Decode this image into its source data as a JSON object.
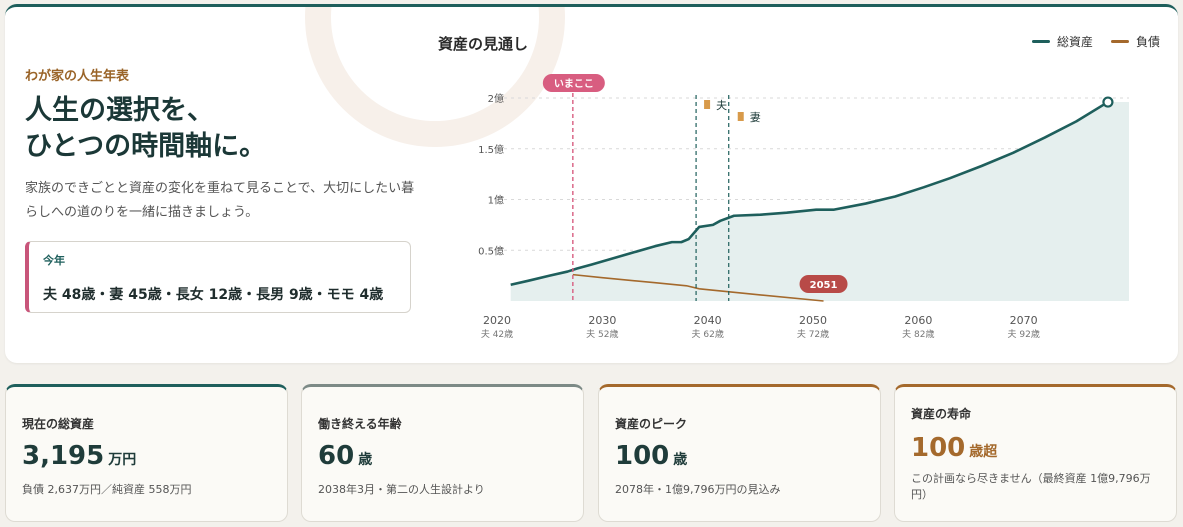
{
  "hero": {
    "eyebrow": "わが家の人生年表",
    "headline_line1": "人生の選択を、",
    "headline_line2": "ひとつの時間軸に。",
    "lead": "家族のできごとと資産の変化を重ねて見ることで、大切にしたい暮らしへの道のりを一緒に描きましょう。",
    "year_label": "今年",
    "members": "夫 48歳・妻 45歳・長女 12歳・長男 9歳・モモ 4歳"
  },
  "chart": {
    "title": "資産の見通し",
    "legend": [
      {
        "label": "総資産",
        "color": "#1e5f5c"
      },
      {
        "label": "負債",
        "color": "#a4692c"
      }
    ]
  },
  "chart_data": {
    "type": "area",
    "title": "資産の見通し",
    "x_range": [
      2020,
      2080
    ],
    "y_range": [
      0,
      2.0
    ],
    "y_unit": "億",
    "y_ticks": [
      {
        "value": 0.5,
        "label": "0.5億"
      },
      {
        "value": 1.0,
        "label": "1億"
      },
      {
        "value": 1.5,
        "label": "1.5億"
      },
      {
        "value": 2.0,
        "label": "2億"
      }
    ],
    "x_ticks": [
      {
        "year": 2020,
        "age": "夫 42歳"
      },
      {
        "year": 2030,
        "age": "夫 52歳"
      },
      {
        "year": 2040,
        "age": "夫 62歳"
      },
      {
        "year": 2050,
        "age": "夫 72歳"
      },
      {
        "year": 2060,
        "age": "夫 82歳"
      },
      {
        "year": 2070,
        "age": "夫 92歳"
      }
    ],
    "series": [
      {
        "name": "総資産",
        "color": "#1e5f5c",
        "x": [
          2021.3,
          2023,
          2025,
          2026.7,
          2027.6,
          2029,
          2031,
          2033,
          2035,
          2036.6,
          2037.5,
          2038.2,
          2039.2,
          2040.5,
          2041.2,
          2042.5,
          2045,
          2047.5,
          2050.3,
          2052,
          2055,
          2057.8,
          2060.5,
          2063,
          2066,
          2069,
          2072,
          2075,
          2078
        ],
        "values": [
          0.16,
          0.2,
          0.25,
          0.29,
          0.32,
          0.36,
          0.42,
          0.48,
          0.54,
          0.58,
          0.58,
          0.61,
          0.73,
          0.75,
          0.79,
          0.84,
          0.85,
          0.87,
          0.9,
          0.9,
          0.96,
          1.03,
          1.12,
          1.21,
          1.33,
          1.46,
          1.61,
          1.77,
          1.96
        ]
      },
      {
        "name": "負債",
        "color": "#a4692c",
        "x": [
          2027.2,
          2030,
          2035,
          2038,
          2039.2,
          2045,
          2051
        ],
        "values": [
          0.26,
          0.23,
          0.18,
          0.15,
          0.12,
          0.06,
          0.0
        ]
      }
    ],
    "markers": [
      {
        "type": "now",
        "label": "いまここ",
        "year": 2027.2,
        "color": "#d85d80"
      },
      {
        "type": "retire",
        "label": "夫",
        "year": 2038.9,
        "color": "#1e5f5c"
      },
      {
        "type": "retire",
        "label": "妻",
        "year": 2042.0,
        "color": "#1e5f5c"
      },
      {
        "type": "debt-end",
        "label": "2051",
        "year": 2051,
        "color": "#b84a47"
      }
    ]
  },
  "cards": [
    {
      "title": "現在の総資産",
      "value": "3,195",
      "unit": "万円",
      "sub": "負債 2,637万円／純資産 558万円"
    },
    {
      "title": "働き終える年齢",
      "value": "60",
      "unit": "歳",
      "sub": "2038年3月・第二の人生設計より"
    },
    {
      "title": "資産のピーク",
      "value": "100",
      "unit": "歳",
      "sub": "2078年・1億9,796万円の見込み"
    },
    {
      "title": "資産の寿命",
      "value": "100",
      "unit": "歳超",
      "sub": "この計画なら尽きません（最終資産 1億9,796万円）"
    }
  ]
}
